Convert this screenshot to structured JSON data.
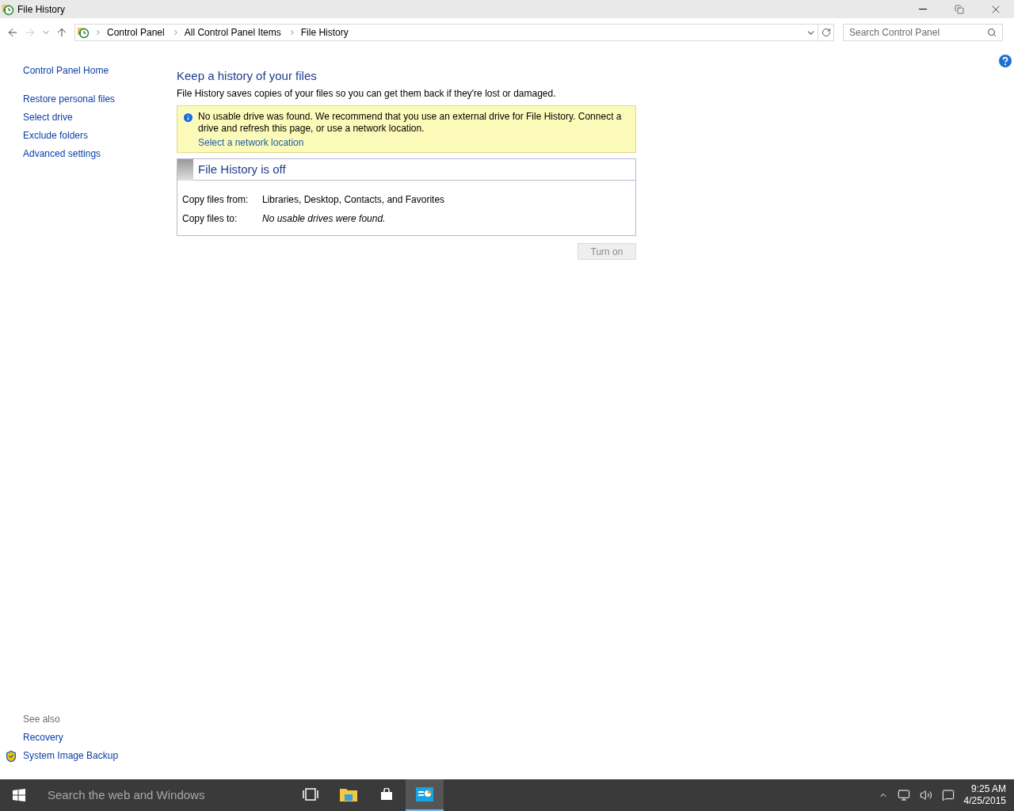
{
  "window": {
    "title": "File History"
  },
  "address_bar": {
    "back_disabled": false,
    "forward_disabled": true,
    "breadcrumbs": [
      "Control Panel",
      "All Control Panel Items",
      "File History"
    ]
  },
  "search": {
    "placeholder": "Search Control Panel"
  },
  "sidebar": {
    "items": [
      "Control Panel Home",
      "Restore personal files",
      "Select drive",
      "Exclude folders",
      "Advanced settings"
    ],
    "see_also": {
      "heading": "See also",
      "items": [
        {
          "label": "Recovery",
          "kind": "plain"
        },
        {
          "label": "System Image Backup",
          "kind": "shield"
        }
      ]
    }
  },
  "main": {
    "heading": "Keep a history of your files",
    "description": "File History saves copies of your files so you can get them back if they're lost or damaged.",
    "notice": {
      "message": "No usable drive was found. We recommend that you use an external drive for File History. Connect a drive and refresh this page, or use a network location.",
      "link": "Select a network location"
    },
    "status": {
      "title": "File History is off",
      "rows": [
        {
          "label": "Copy files from:",
          "value": "Libraries, Desktop, Contacts, and Favorites",
          "italic": false
        },
        {
          "label": "Copy files to:",
          "value": "No usable drives were found.",
          "italic": true
        }
      ]
    },
    "turn_on_button": {
      "label": "Turn on",
      "disabled": true
    }
  },
  "taskbar": {
    "search_placeholder": "Search the web and Windows",
    "apps": [
      {
        "kind": "task-view",
        "selected": false
      },
      {
        "kind": "explorer",
        "selected": false
      },
      {
        "kind": "store",
        "selected": false
      },
      {
        "kind": "control-panel",
        "selected": true
      }
    ],
    "time": "9:25 AM",
    "date": "4/25/2015"
  }
}
